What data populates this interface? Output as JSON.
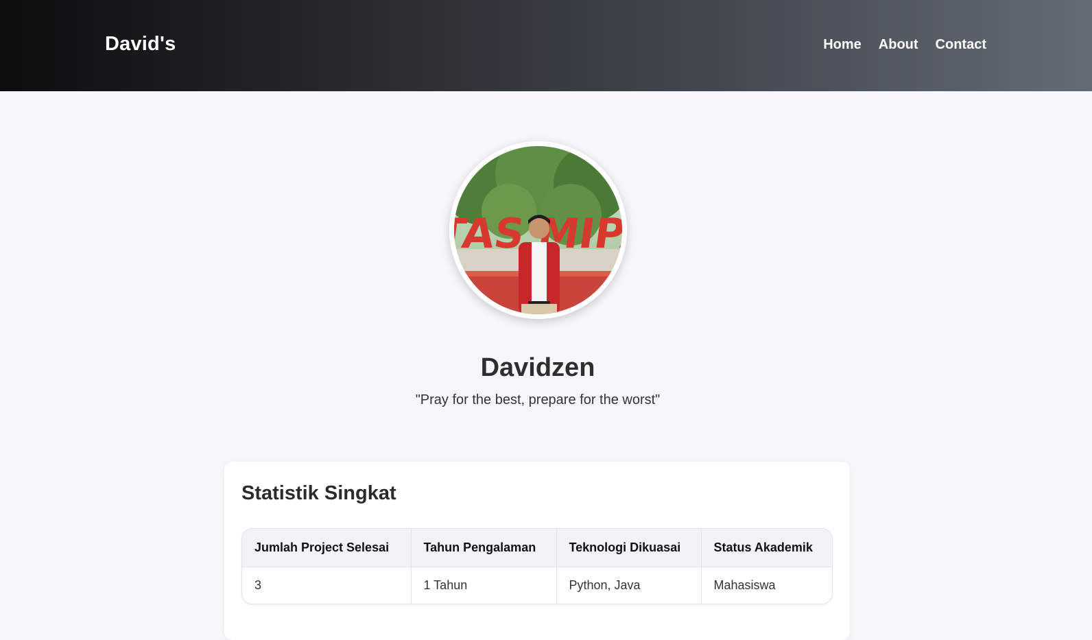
{
  "navbar": {
    "brand": "David's",
    "links": [
      "Home",
      "About",
      "Contact"
    ]
  },
  "profile": {
    "name": "Davidzen",
    "quote": "\"Pray for the best, prepare for the worst\"",
    "photo_sign_text": "TAS MIPA"
  },
  "stats": {
    "title": "Statistik Singkat",
    "headers": [
      "Jumlah Project Selesai",
      "Tahun Pengalaman",
      "Teknologi Dikuasai",
      "Status Akademik"
    ],
    "row": [
      "3",
      "1 Tahun",
      "Python, Java",
      "Mahasiswa"
    ]
  },
  "colors": {
    "page_bg": "#f7f6fa",
    "nav_start": "#0d0d0e",
    "nav_end": "#656b75",
    "text": "#2b2b2b"
  }
}
